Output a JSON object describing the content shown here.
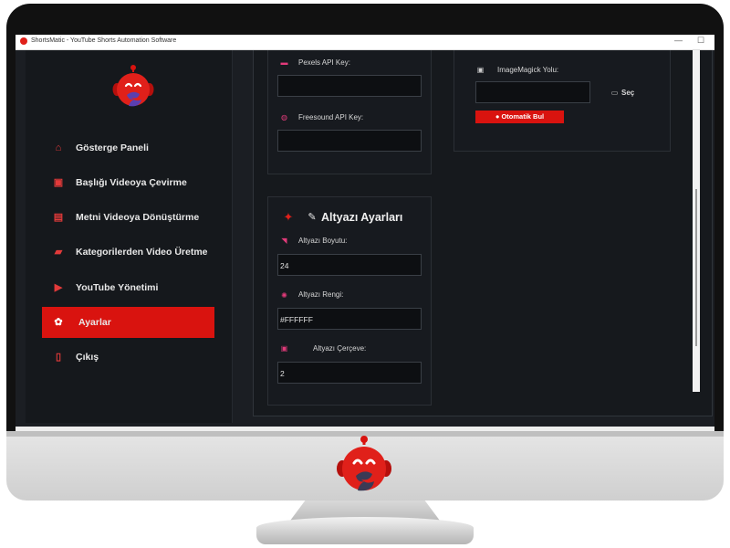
{
  "window": {
    "title": "ShortsMatic - YouTube Shorts Automation Software",
    "minimize": "—",
    "maximize": "☐"
  },
  "brand": {
    "accent": "#d9130f",
    "logo_icon": "robot-s-logo-icon"
  },
  "sidebar": {
    "items": [
      {
        "label": "Gösterge Paneli",
        "icon": "dashboard-icon",
        "active": false
      },
      {
        "label": "Başlığı Videoya Çevirme",
        "icon": "title-video-icon",
        "active": false
      },
      {
        "label": "Metni Videoya Dönüştürme",
        "icon": "document-icon",
        "active": false
      },
      {
        "label": "Kategorilerden Video Üretme",
        "icon": "clapperboard-icon",
        "active": false
      },
      {
        "label": "YouTube Yönetimi",
        "icon": "youtube-icon",
        "active": false
      },
      {
        "label": "Ayarlar",
        "icon": "gear-icon",
        "active": true
      },
      {
        "label": "Çıkış",
        "icon": "exit-icon",
        "active": false
      }
    ]
  },
  "api": {
    "pexels_label": "Pexels API Key:",
    "pexels_value": "",
    "freesound_label": "Freesound API Key:",
    "freesound_value": ""
  },
  "imagemagick": {
    "label": "ImageMagick Yolu:",
    "value": "",
    "browse_label": "Seç",
    "auto_find_label": "Otomatik Bul"
  },
  "subtitles": {
    "title": "Altyazı Ayarları",
    "size_label": "Altyazı Boyutu:",
    "size_value": "24",
    "color_label": "Altyazı Rengi:",
    "color_value": "#FFFFFF",
    "border_label": "Altyazı Çerçeve:",
    "border_value": "2"
  }
}
